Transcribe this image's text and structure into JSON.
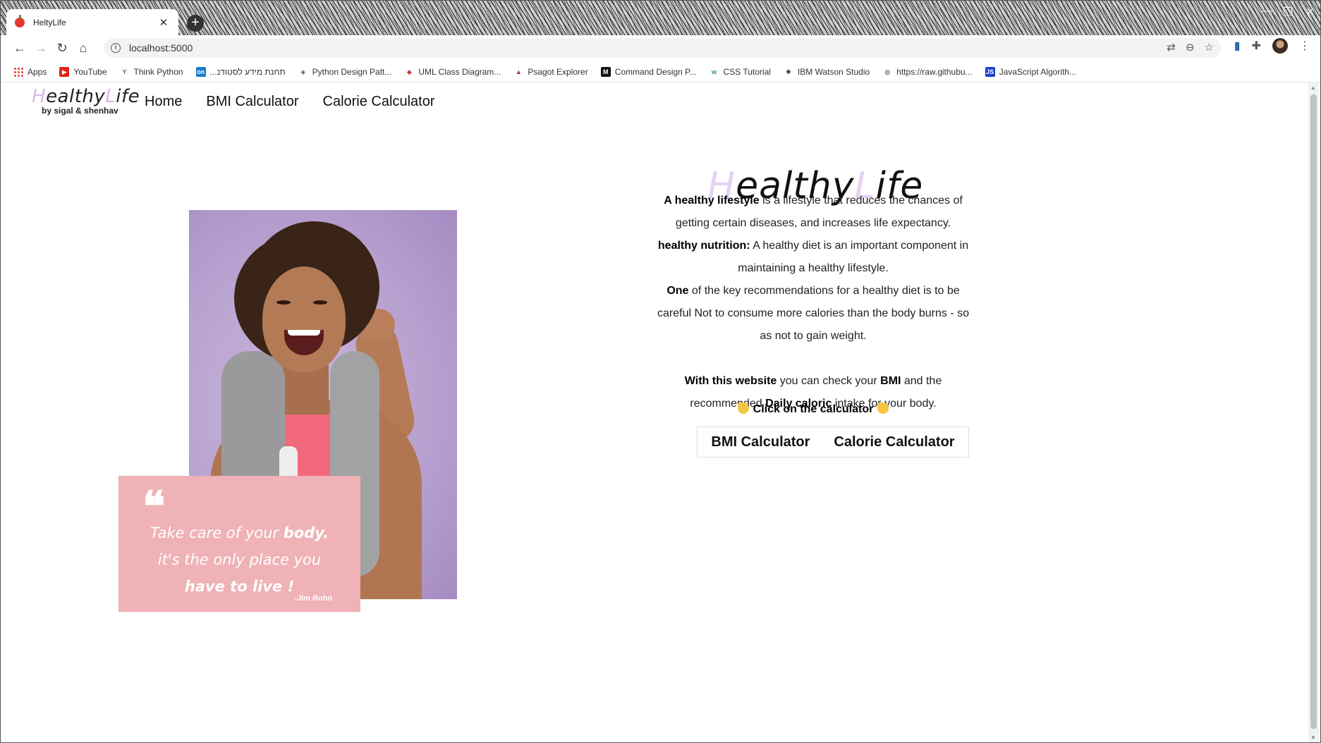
{
  "browser": {
    "tab_title": "HeltyLife",
    "tab_close": "✕",
    "new_tab": "+",
    "url": "localhost:5000",
    "bookmarks": [
      {
        "label": "Apps",
        "icon": "apps-grid-icon"
      },
      {
        "label": "YouTube",
        "icon": "youtube-icon"
      },
      {
        "label": "Think Python",
        "icon": "think-python-icon"
      },
      {
        "label": "...תחנת מידע לסטודנ",
        "icon": "on-icon"
      },
      {
        "label": "Python Design Patt...",
        "icon": "python-design-icon"
      },
      {
        "label": "UML Class Diagram...",
        "icon": "uml-icon"
      },
      {
        "label": "Psagot Explorer",
        "icon": "psagot-icon"
      },
      {
        "label": "Command Design P...",
        "icon": "medium-icon"
      },
      {
        "label": "CSS Tutorial",
        "icon": "w3schools-icon"
      },
      {
        "label": "IBM Watson Studio",
        "icon": "ibm-watson-icon"
      },
      {
        "label": "https://raw.githubu...",
        "icon": "globe-icon"
      },
      {
        "label": "JavaScript Algorith...",
        "icon": "js-icon"
      }
    ]
  },
  "site": {
    "brand_h": "H",
    "brand_ealthy": "ealthy",
    "brand_l": "L",
    "brand_ife": "ife",
    "brand_by": "by sigal & shenhav",
    "nav": [
      "Home",
      "BMI Calculator",
      "Calorie Calculator"
    ]
  },
  "quote": {
    "mark": "❝",
    "line1_a": "Take care ",
    "line1_b": "of your ",
    "line1_c": "body.",
    "line2": "it's the only place you",
    "line3": "have to live !",
    "author": "-Jim Rohn"
  },
  "hero": {
    "h": "H",
    "ealthy": "ealthy",
    "l": "L",
    "ife": "ife"
  },
  "intro": {
    "p1_bold": "A healthy lifestyle",
    "p1_rest": " is a lifestyle that reduces the chances of getting certain diseases, and increases life expectancy.",
    "p2_bold": "healthy nutrition:",
    "p2_rest": " A healthy diet is an important component in maintaining a healthy lifestyle.",
    "p3_bold": "One",
    "p3_rest": " of the key recommendations for a healthy diet is to be careful Not to consume more calories than the body burns - so as not to gain weight.",
    "p4_bold1": "With this website",
    "p4_mid1": " you can check your ",
    "p4_bold2": "BMI",
    "p4_mid2": " and the recommended ",
    "p4_bold3": "Daily caloric",
    "p4_end": " intake for your body."
  },
  "cta": {
    "text": "Click on the calculator"
  },
  "calculators": [
    "BMI Calculator",
    "Calorie Calculator"
  ]
}
